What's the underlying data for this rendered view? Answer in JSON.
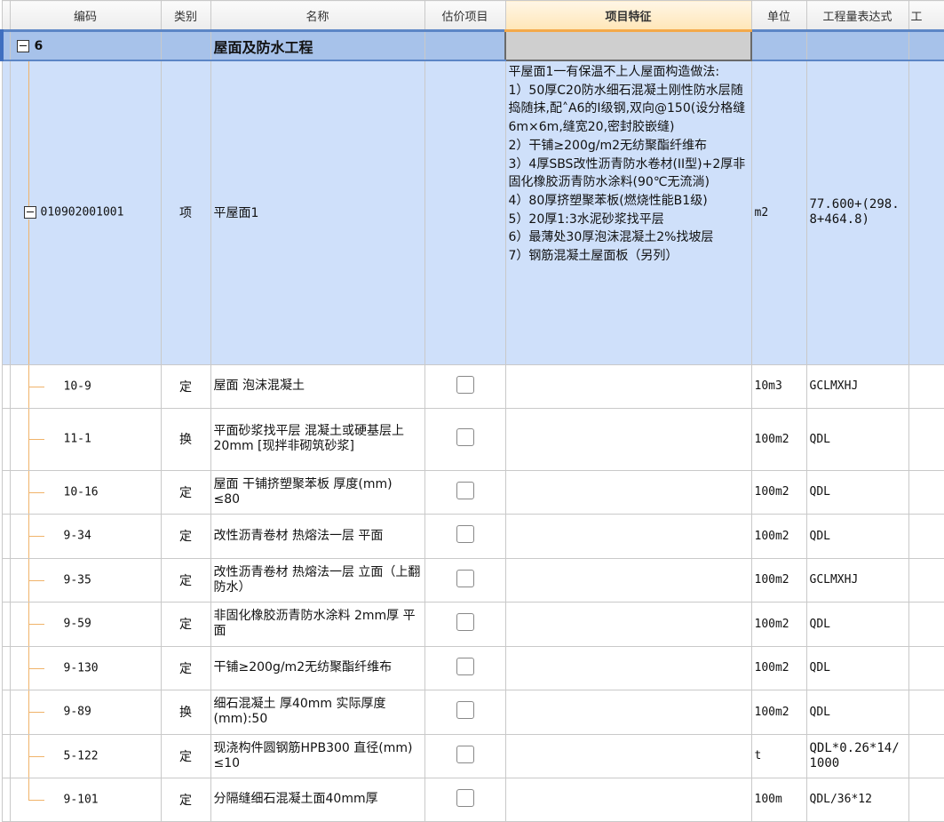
{
  "columns": [
    "编码",
    "类别",
    "名称",
    "估价项目",
    "项目特征",
    "单位",
    "工程量表达式",
    "工"
  ],
  "section": {
    "code": "6",
    "name": "屋面及防水工程"
  },
  "list_item": {
    "code": "010902001001",
    "type": "项",
    "name": "平屋面1",
    "unit": "m2",
    "expression": "77.600+(298.8+464.8)",
    "feature_lines": [
      "平屋面1一有保温不上人屋面构造做法:",
      "1）50厚C20防水细石混凝土刚性防水层随捣随抹,配˄A6的Ⅰ级钢,双向@150(设分格缝6m×6m,缝宽20,密封胶嵌缝)",
      "2）干铺≥200g/m2无纺聚酯纤维布",
      "3）4厚SBS改性沥青防水卷材(II型)+2厚非固化橡胶沥青防水涂料(90℃无流淌)",
      "4）80厚挤塑聚苯板(燃烧性能B1级)",
      "5）20厚1:3水泥砂浆找平层",
      "6）最薄处30厚泡沫混凝土2%找坡层",
      "7）钢筋混凝土屋面板（另列）"
    ]
  },
  "rows": [
    {
      "code": "10-9",
      "type": "定",
      "name": "屋面 泡沫混凝土",
      "unit": "10m3",
      "expression": "GCLMXHJ"
    },
    {
      "code": "11-1",
      "type": "换",
      "name": "平面砂浆找平层 混凝土或硬基层上 20mm [现拌非砌筑砂浆]",
      "unit": "100m2",
      "expression": "QDL"
    },
    {
      "code": "10-16",
      "type": "定",
      "name": "屋面 干铺挤塑聚苯板 厚度(mm) ≤80",
      "unit": "100m2",
      "expression": "QDL"
    },
    {
      "code": "9-34",
      "type": "定",
      "name": "改性沥青卷材 热熔法一层 平面",
      "unit": "100m2",
      "expression": "QDL"
    },
    {
      "code": "9-35",
      "type": "定",
      "name": "改性沥青卷材 热熔法一层 立面（上翻防水）",
      "unit": "100m2",
      "expression": "GCLMXHJ"
    },
    {
      "code": "9-59",
      "type": "定",
      "name": "非固化橡胶沥青防水涂料 2mm厚 平面",
      "unit": "100m2",
      "expression": "QDL"
    },
    {
      "code": "9-130",
      "type": "定",
      "name": "干铺≥200g/m2无纺聚酯纤维布",
      "unit": "100m2",
      "expression": "QDL"
    },
    {
      "code": "9-89",
      "type": "换",
      "name": "细石混凝土 厚40mm  实际厚度(mm):50",
      "unit": "100m2",
      "expression": "QDL"
    },
    {
      "code": "5-122",
      "type": "定",
      "name": "现浇构件圆钢筋HPB300 直径(mm) ≤10",
      "unit": "t",
      "expression": "QDL*0.26*14/1000"
    },
    {
      "code": "9-101",
      "type": "定",
      "name": "分隔缝细石混凝土面40mm厚",
      "unit": "100m",
      "expression": "QDL/36*12"
    }
  ]
}
